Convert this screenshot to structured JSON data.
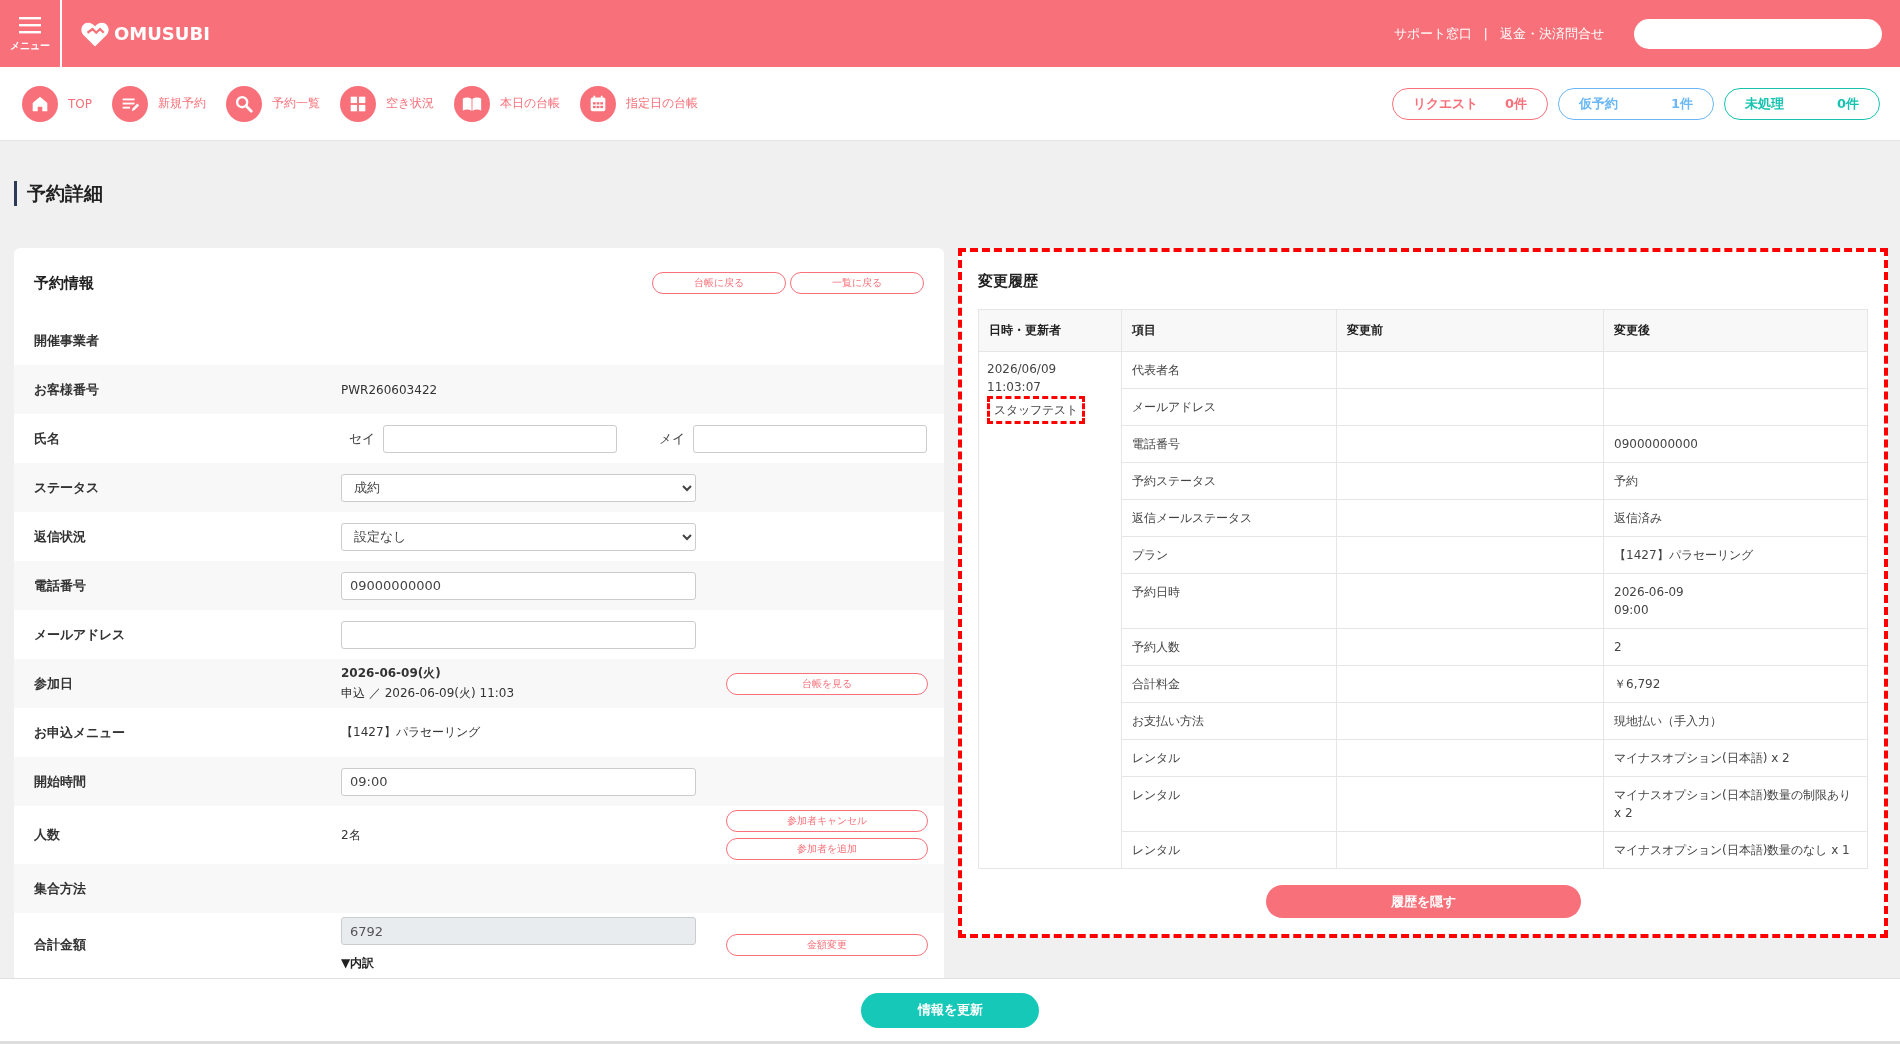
{
  "header": {
    "menu_label": "メニュー",
    "logo": "OMUSUBI",
    "links": [
      "サポート窓口",
      "返金・決済問合せ"
    ],
    "separator": "|"
  },
  "nav": [
    {
      "label": "TOP"
    },
    {
      "label": "新規予約"
    },
    {
      "label": "予約一覧"
    },
    {
      "label": "空き状況"
    },
    {
      "label": "本日の台帳"
    },
    {
      "label": "指定日の台帳"
    }
  ],
  "counters": [
    {
      "label": "リクエスト",
      "count": "0件",
      "color": "#f87079"
    },
    {
      "label": "仮予約",
      "count": "1件",
      "color": "#6ab8f7"
    },
    {
      "label": "未処理",
      "count": "0件",
      "color": "#16c3b0"
    }
  ],
  "page_title": "予約詳細",
  "reservation": {
    "title": "予約情報",
    "buttons": [
      "台帳に戻る",
      "一覧に戻る"
    ],
    "rows": [
      {
        "kind": "text",
        "label": "開催事業者"
      },
      {
        "kind": "text",
        "label": "お客様番号",
        "value": "PWR260603422"
      },
      {
        "kind": "name",
        "label": "氏名",
        "fields": [
          {
            "label": "セイ"
          },
          {
            "label": "メイ"
          }
        ]
      },
      {
        "kind": "select",
        "label": "ステータス",
        "value": "成約"
      },
      {
        "kind": "select",
        "label": "返信状況",
        "value": "設定なし"
      },
      {
        "kind": "input",
        "label": "電話番号",
        "value": "09000000000"
      },
      {
        "kind": "input",
        "label": "メールアドレス"
      },
      {
        "kind": "date",
        "label": "参加日",
        "value": "2026-06-09(火)",
        "sub": "申込 ／ 2026-06-09(火) 11:03",
        "buttons": [
          "台帳を見る"
        ]
      },
      {
        "kind": "text",
        "label": "お申込メニュー",
        "value": "【1427】パラセーリング"
      },
      {
        "kind": "input",
        "label": "開始時間",
        "value": "09:00"
      },
      {
        "kind": "text",
        "label": "人数",
        "value": "2名",
        "buttons": [
          "参加者キャンセル",
          "参加者を追加"
        ]
      },
      {
        "kind": "text",
        "label": "集合方法"
      },
      {
        "kind": "input",
        "label": "合計金額",
        "value": "6792",
        "disabled": true,
        "buttons": [
          "金額変更"
        ],
        "toggle": "▼内訳"
      }
    ]
  },
  "history": {
    "title": "変更履歴",
    "highlighted": true,
    "columns": [
      "日時・更新者",
      "項目",
      "変更前",
      "変更後"
    ],
    "entry": {
      "time": "2026/06/09 11:03:07",
      "updater": "スタッフテスト",
      "updater_highlighted": true
    },
    "changes": [
      {
        "item": "代表者名"
      },
      {
        "item": "メールアドレス"
      },
      {
        "item": "電話番号",
        "after": "09000000000"
      },
      {
        "item": "予約ステータス",
        "after": "予約"
      },
      {
        "item": "返信メールステータス",
        "after": "返信済み"
      },
      {
        "item": "プラン",
        "after": "【1427】パラセーリング"
      },
      {
        "item": "予約日時",
        "after": "2026-06-09\n09:00"
      },
      {
        "item": "予約人数",
        "after": "2"
      },
      {
        "item": "合計料金",
        "after": "￥6,792"
      },
      {
        "item": "お支払い方法",
        "after": "現地払い（手入力）"
      },
      {
        "item": "レンタル",
        "after": "マイナスオプション(日本語) x 2"
      },
      {
        "item": "レンタル",
        "after": "マイナスオプション(日本語)数量の制限あり x 2"
      },
      {
        "item": "レンタル",
        "after": "マイナスオプション(日本語)数量のなし x 1"
      }
    ],
    "hide_button": "履歴を隠す"
  },
  "update_button": "情報を更新"
}
